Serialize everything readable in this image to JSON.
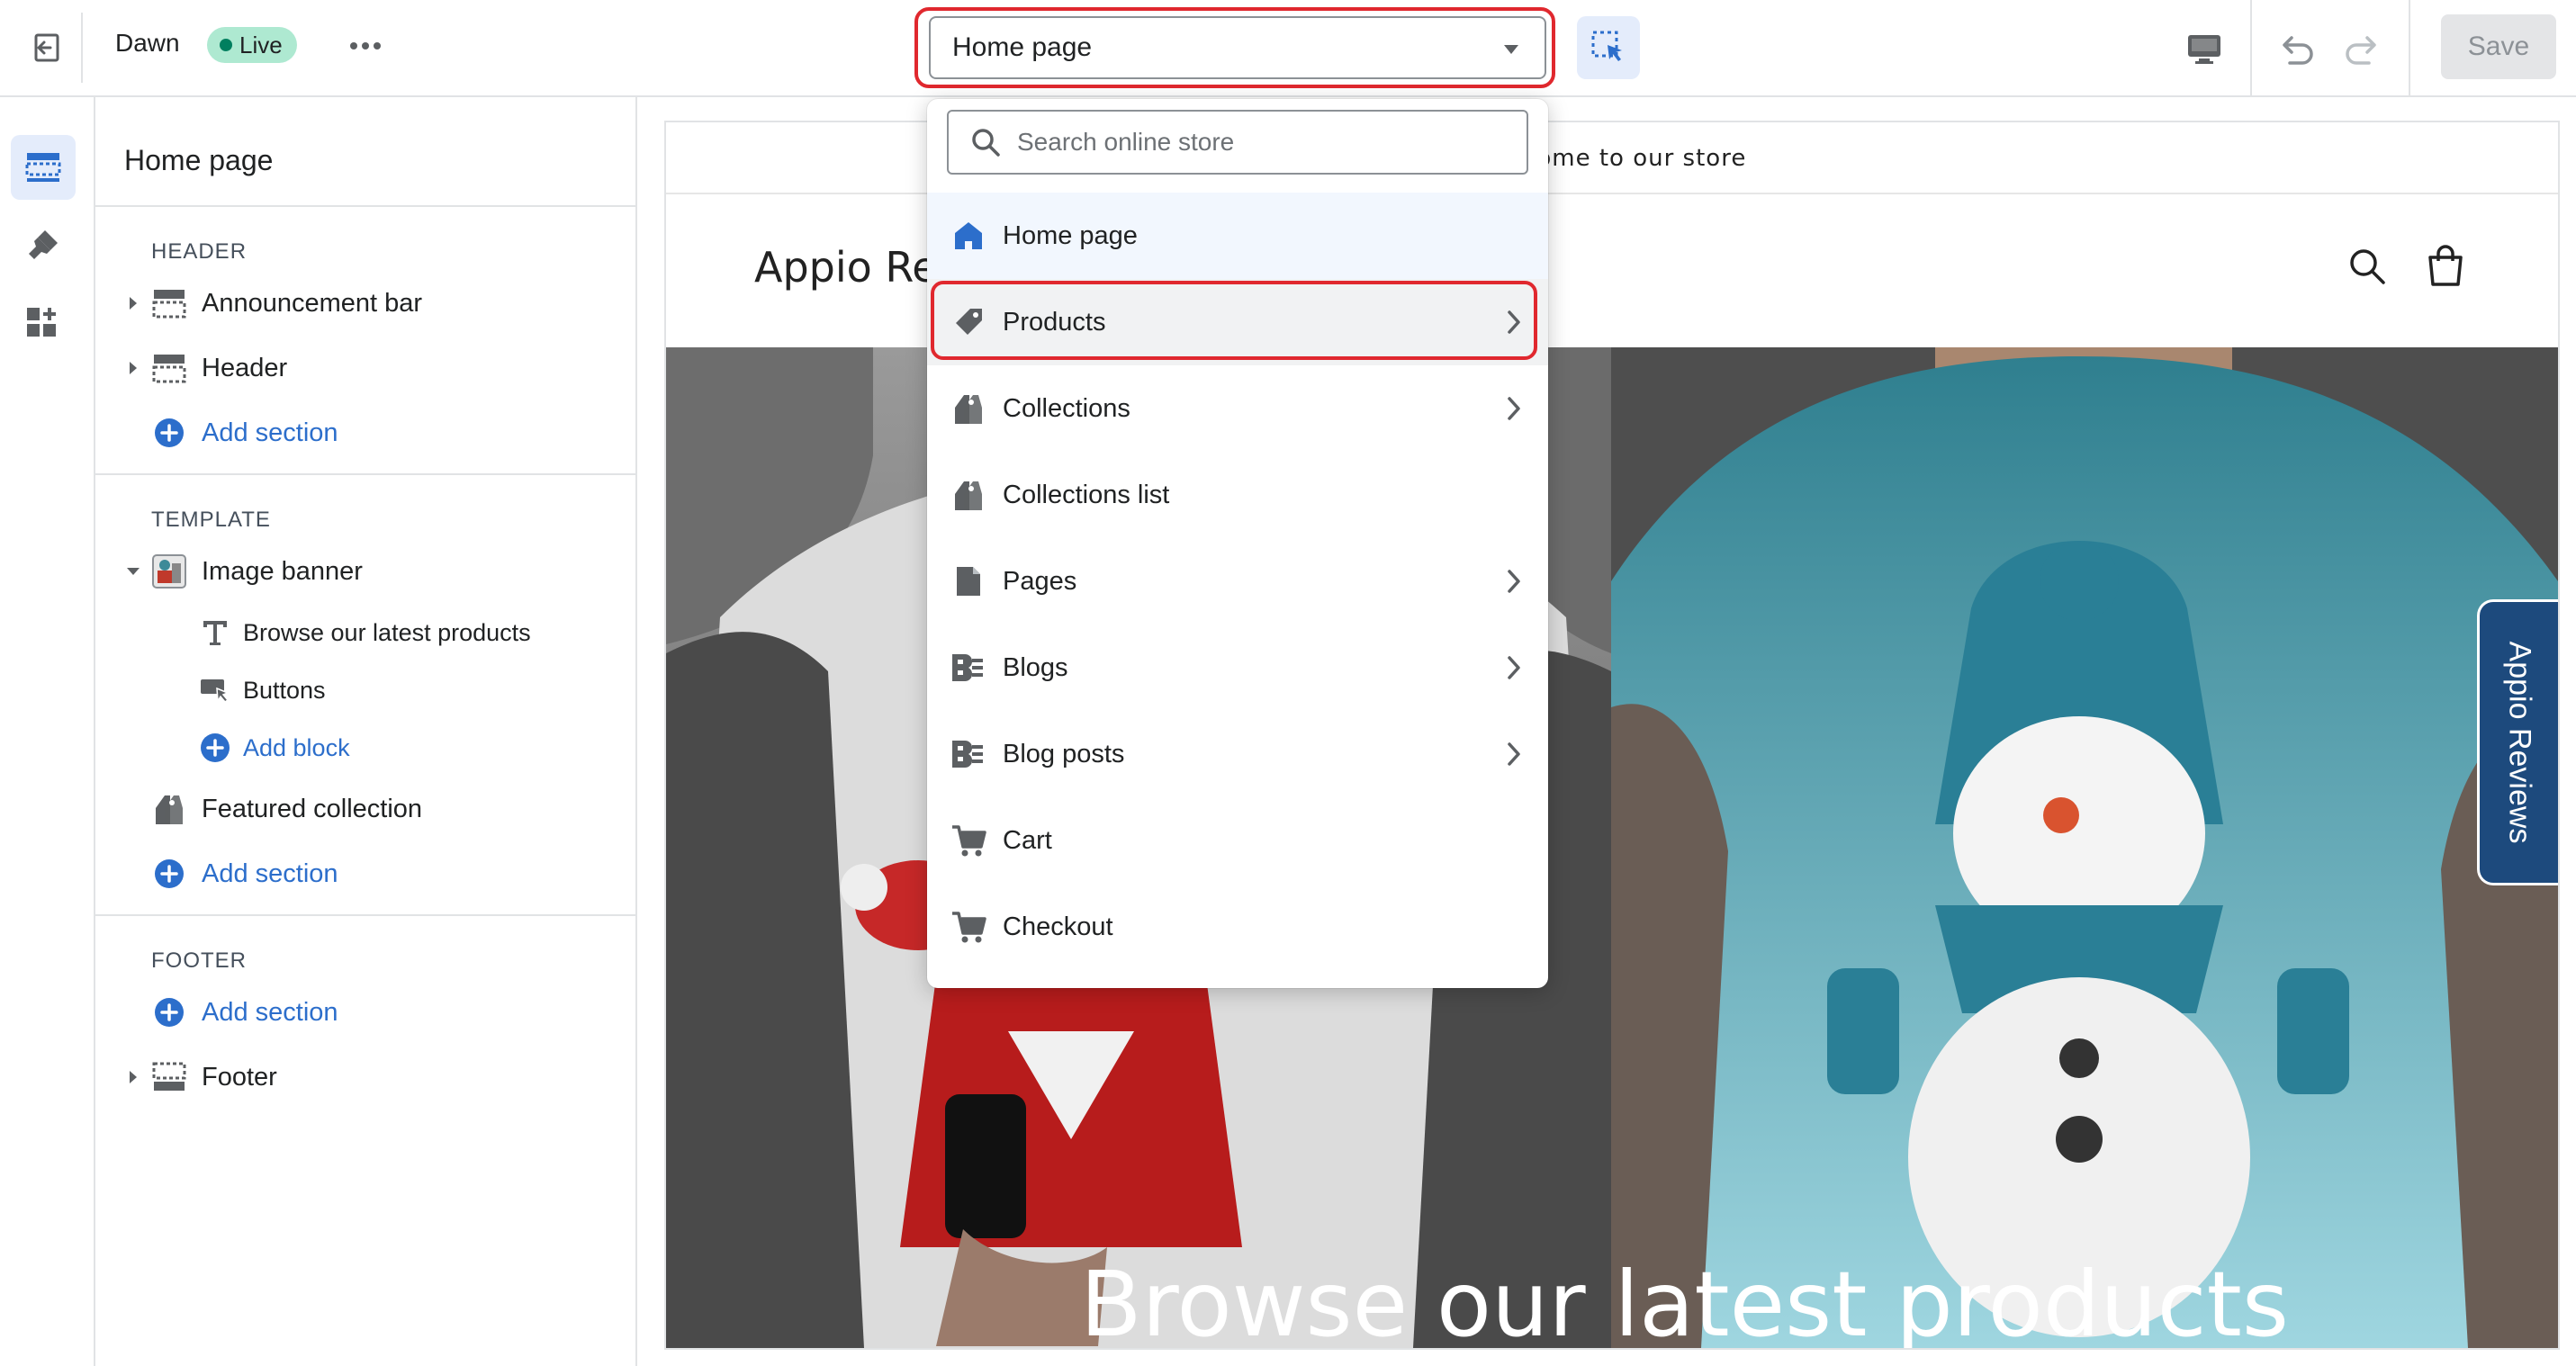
{
  "topbar": {
    "theme_name": "Dawn",
    "live_label": "Live",
    "page_select_value": "Home page",
    "save_label": "Save"
  },
  "sidebar": {
    "title": "Home page",
    "header_group": "HEADER",
    "template_group": "TEMPLATE",
    "footer_group": "FOOTER",
    "announcement_bar": "Announcement bar",
    "header": "Header",
    "add_section": "Add section",
    "image_banner": "Image banner",
    "blocks": [
      "Browse our latest products",
      "Buttons"
    ],
    "add_block": "Add block",
    "featured_collection": "Featured collection",
    "footer": "Footer"
  },
  "dropdown": {
    "search_placeholder": "Search online store",
    "items": [
      "Home page",
      "Products",
      "Collections",
      "Collections list",
      "Pages",
      "Blogs",
      "Blog posts",
      "Cart",
      "Checkout"
    ]
  },
  "preview": {
    "announcement": "Welcome to our store",
    "logo": "Appio Reviews",
    "hero_heading": "Browse our latest products",
    "reviews_tab": "Appio Reviews"
  },
  "colors": {
    "accent": "#2c6ecb",
    "highlight": "#e0282e",
    "live_bg": "#aee9d1",
    "reviews_tab": "#1d4a7d"
  }
}
